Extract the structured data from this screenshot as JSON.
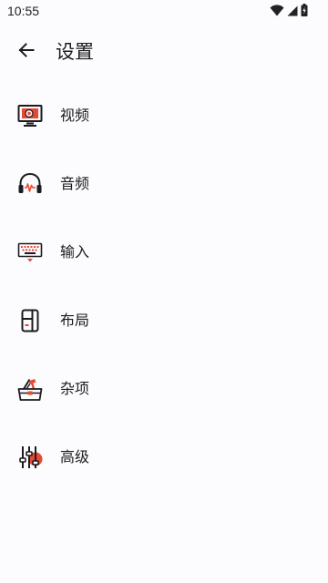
{
  "status_bar": {
    "time": "10:55",
    "icons": [
      "wifi-icon",
      "signal-icon",
      "battery-charging-icon"
    ]
  },
  "app_bar": {
    "back_icon": "arrow-back-icon",
    "title": "设置"
  },
  "colors": {
    "accent": "#e64a32",
    "text": "#1c1b1f",
    "background": "#fcfbfe"
  },
  "menu": {
    "items": [
      {
        "label": "视频",
        "icon": "monitor-icon"
      },
      {
        "label": "音频",
        "icon": "headphones-icon"
      },
      {
        "label": "输入",
        "icon": "keyboard-icon"
      },
      {
        "label": "布局",
        "icon": "layout-icon"
      },
      {
        "label": "杂项",
        "icon": "toolbox-icon"
      },
      {
        "label": "高级",
        "icon": "sliders-icon"
      }
    ]
  }
}
